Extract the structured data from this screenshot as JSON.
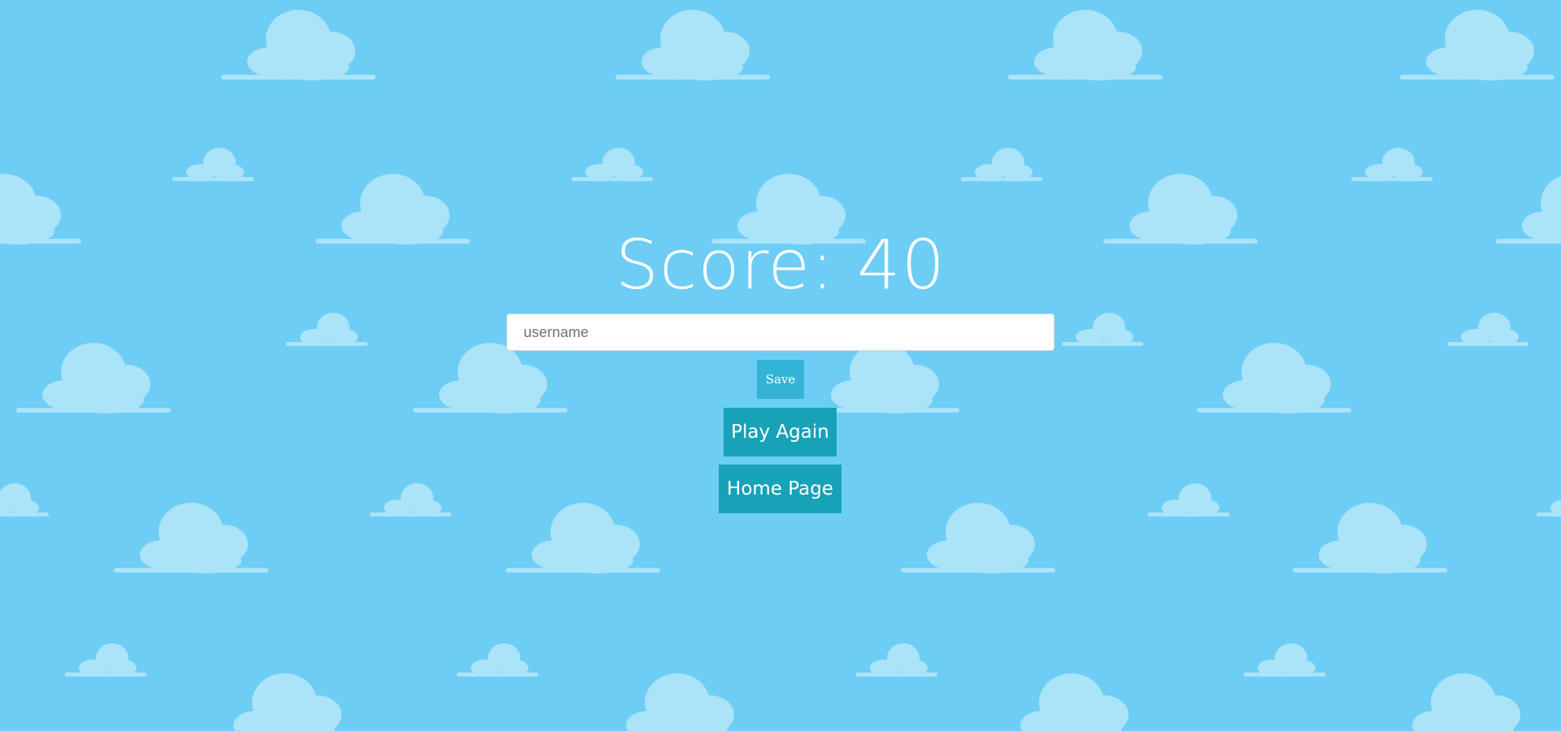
{
  "score": {
    "label": "Score: 40",
    "value": 40
  },
  "form": {
    "username_placeholder": "username",
    "username_value": "",
    "save_label": "Save"
  },
  "actions": {
    "play_again_label": "Play Again",
    "home_page_label": "Home Page"
  },
  "theme": {
    "sky_color": "#6dcdf5",
    "cloud_color": "#abe3f8",
    "primary_button_color": "#17a2b8",
    "save_button_color": "#33b3d6",
    "text_color": "#ffffff",
    "background_pattern": "cloud-icon"
  }
}
